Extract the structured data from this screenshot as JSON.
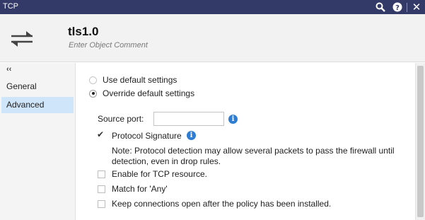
{
  "window": {
    "title": "TCP"
  },
  "titlebar_icons": [
    "search-icon",
    "help-icon",
    "close-icon"
  ],
  "object": {
    "name": "tls1.0",
    "comment_placeholder": "Enter Object Comment",
    "icon": "tcp-arrows-icon"
  },
  "sidebar": {
    "collapse_glyph": "‹‹",
    "items": [
      {
        "label": "General",
        "selected": false
      },
      {
        "label": "Advanced",
        "selected": true
      }
    ]
  },
  "advanced": {
    "settings_mode": {
      "options": [
        "Use default settings",
        "Override default settings"
      ],
      "selected": "Override default settings"
    },
    "source_port": {
      "label": "Source port:",
      "value": ""
    },
    "protocol_signature": {
      "label": "Protocol Signature",
      "checked": true
    },
    "note": "Note: Protocol detection may allow several packets to pass the firewall until detection, even in drop rules.",
    "enable_tcp_resource": {
      "label": "Enable for TCP resource.",
      "checked": false
    },
    "match_any": {
      "label": "Match for 'Any'",
      "checked": false
    },
    "keep_connections": {
      "label": "Keep connections open after the policy has been installed.",
      "checked": false
    }
  },
  "colors": {
    "titlebar": "#343a68",
    "selected_nav": "#cfe5f9",
    "info_icon": "#2f7dd3"
  }
}
